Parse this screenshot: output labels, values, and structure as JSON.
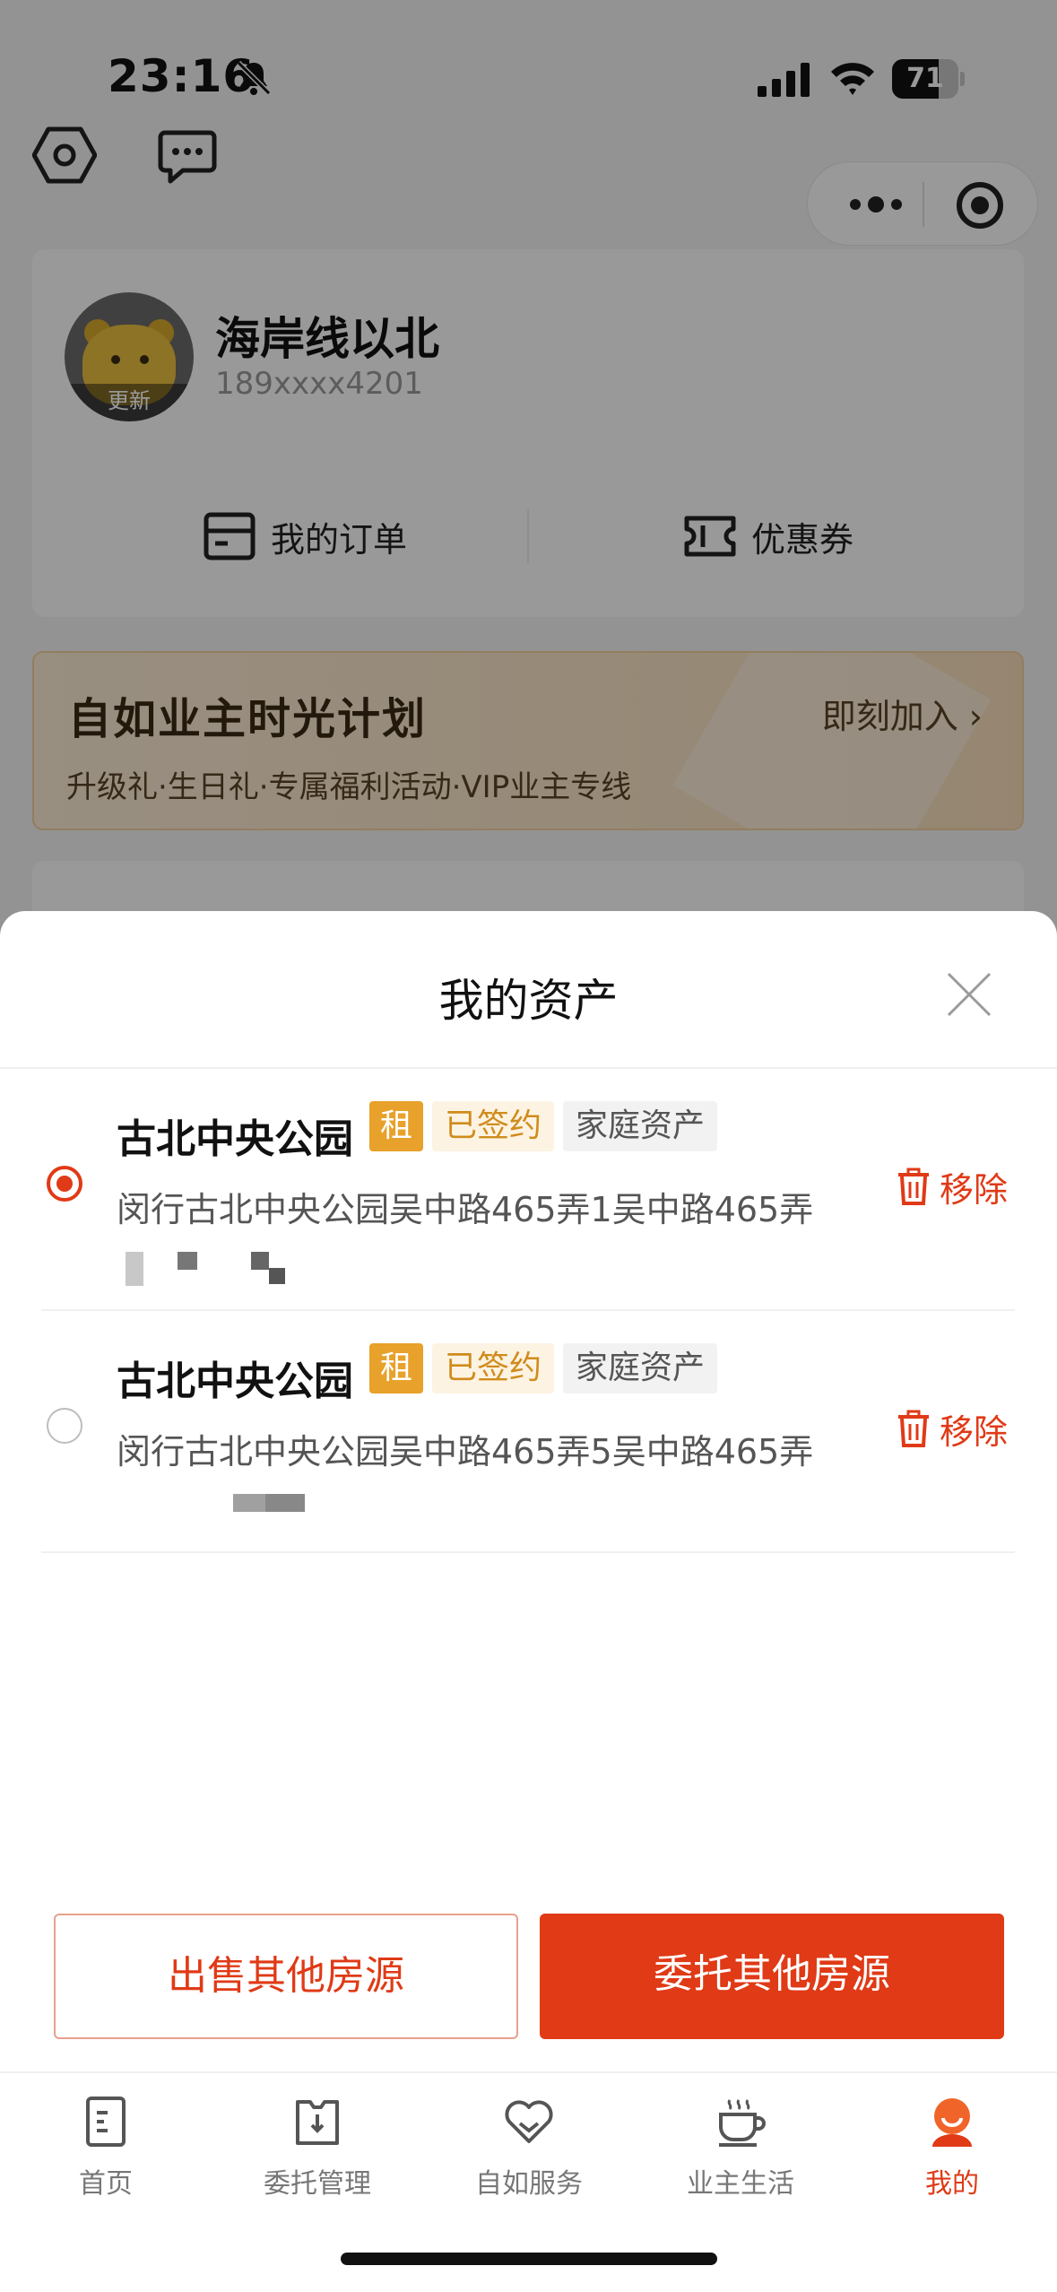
{
  "status_bar": {
    "time": "23:16",
    "battery": "71",
    "battery_level": 0.71
  },
  "header": {
    "settings_icon": "settings-hex-icon",
    "message_icon": "message-icon"
  },
  "profile": {
    "avatar_badge": "更新",
    "name": "海岸线以北",
    "phone": "189xxxx4201",
    "orders_label": "我的订单",
    "coupons_label": "优惠券"
  },
  "banner": {
    "title": "自如业主时光计划",
    "join": "即刻加入 ›",
    "subtitle": "升级礼·生日礼·专属福利活动·VIP业主专线"
  },
  "sheet": {
    "title": "我的资产",
    "remove_label": "移除",
    "assets": [
      {
        "name": "古北中央公园",
        "tag_rent": "租",
        "tag_status": "已签约",
        "tag_type": "家庭资产",
        "address": "闵行古北中央公园吴中路465弄1吴中路465弄",
        "selected": true
      },
      {
        "name": "古北中央公园",
        "tag_rent": "租",
        "tag_status": "已签约",
        "tag_type": "家庭资产",
        "address": "闵行古北中央公园吴中路465弄5吴中路465弄",
        "selected": false
      }
    ],
    "sell_button": "出售其他房源",
    "entrust_button": "委托其他房源"
  },
  "tabbar": {
    "items": [
      {
        "label": "首页",
        "icon": "home-doc-icon"
      },
      {
        "label": "委托管理",
        "icon": "entrust-icon"
      },
      {
        "label": "自如服务",
        "icon": "heart-service-icon"
      },
      {
        "label": "业主生活",
        "icon": "coffee-cup-icon"
      },
      {
        "label": "我的",
        "icon": "profile-icon",
        "active": true
      }
    ]
  },
  "colors": {
    "accent": "#e03a16",
    "tag_rent": "#e8a12a",
    "tag_signed_text": "#d08c1c"
  }
}
